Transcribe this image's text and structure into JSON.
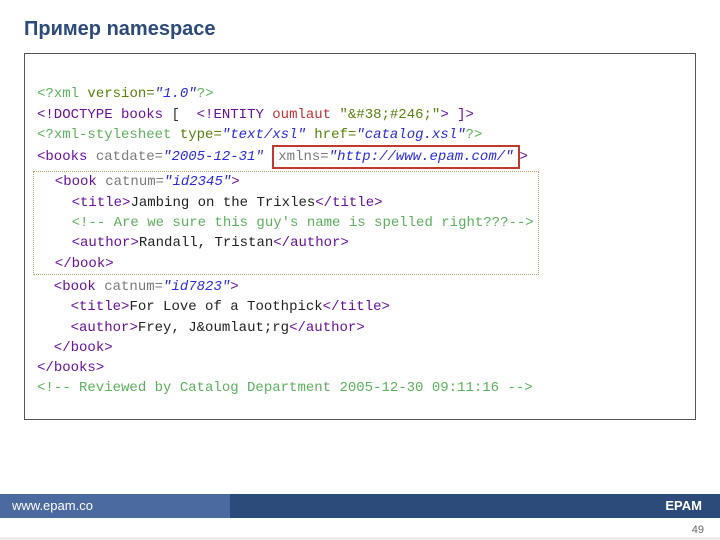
{
  "title": "Пример namespace",
  "lines": {
    "l1": {
      "pi_open": "<?",
      "pi_tgt": "xml",
      "ver_attr": " version=",
      "ver_val": "\"1.0\"",
      "pi_close": "?>"
    },
    "l2": {
      "open": "<!DOCTYPE",
      "name": " books",
      "brack": " [  ",
      "ent_open": "<!ENTITY",
      "ent_name": " oumlaut",
      "ent_val": " \"&#38;#246;\"",
      "ent_close": ">",
      "close": " ]>"
    },
    "l3": {
      "pi_open": "<?",
      "pi_tgt": "xml-stylesheet",
      "type_attr": " type=",
      "type_val": "\"text/xsl\"",
      "href_attr": " href=",
      "href_val": "\"catalog.xsl\"",
      "pi_close": "?>"
    },
    "l4": {
      "open": "<",
      "tag": "books",
      "catdate_attr": " catdate=",
      "catdate_val": "\"2005-12-31\"",
      "ns_attr": "xmlns=",
      "ns_val": "\"http://www.epam.com/\"",
      "close": ">"
    },
    "l5": {
      "open": "  <",
      "tag": "book",
      "catnum_attr": " catnum=",
      "catnum_val": "\"id2345\"",
      "close": ">"
    },
    "l6": {
      "open": "    <",
      "tag_o": "title",
      "gt": ">",
      "text": "Jambing on the Trixles",
      "ctag_o": "</",
      "tag_c": "title",
      "ctag_c": ">"
    },
    "l7": {
      "cmt": "    <!-- Are we sure this guy's name is spelled right???-->"
    },
    "l8": {
      "open": "    <",
      "tag_o": "author",
      "gt": ">",
      "text": "Randall, Tristan",
      "ctag_o": "</",
      "tag_c": "author",
      "ctag_c": ">"
    },
    "l9": {
      "open": "  </",
      "tag": "book",
      "close": ">"
    },
    "l10": {
      "open": "  <",
      "tag": "book",
      "catnum_attr": " catnum=",
      "catnum_val": "\"id7823\"",
      "close": ">"
    },
    "l11": {
      "open": "    <",
      "tag_o": "title",
      "gt": ">",
      "text": "For Love of a Toothpick",
      "ctag_o": "</",
      "tag_c": "title",
      "ctag_c": ">"
    },
    "l12": {
      "open": "    <",
      "tag_o": "author",
      "gt": ">",
      "text_a": "Frey, J",
      "ent": "&oumlaut;",
      "text_b": "rg",
      "ctag_o": "</",
      "tag_c": "author",
      "ctag_c": ">"
    },
    "l13": {
      "open": "  </",
      "tag": "book",
      "close": ">"
    },
    "l14": {
      "open": "</",
      "tag": "books",
      "close": ">"
    },
    "l15": {
      "cmt": "<!-- Reviewed by Catalog Department 2005-12-30 09:11:16 -->"
    }
  },
  "footer": {
    "left": "www.epam.co",
    "right": "EPAM"
  },
  "page": "49"
}
